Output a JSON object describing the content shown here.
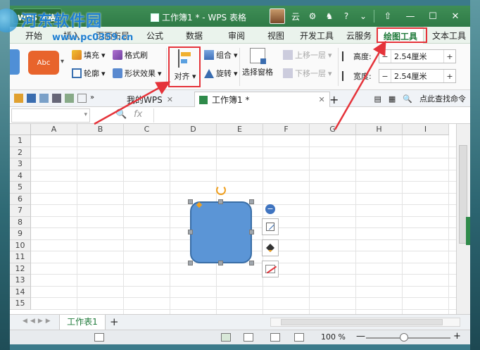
{
  "watermark": {
    "name": "河东软件园",
    "url": "www.pc0359.cn"
  },
  "titlebar": {
    "app_label": "WPS 表格",
    "doc_title": "工作簿1 * - WPS 表格",
    "user_label": "云",
    "min": "—",
    "max": "☐",
    "close": "✕"
  },
  "tabs": [
    {
      "label": "开始"
    },
    {
      "label": "插入"
    },
    {
      "label": "页面布局"
    },
    {
      "label": "公式"
    },
    {
      "label": "数据"
    },
    {
      "label": "审阅"
    },
    {
      "label": "视图"
    },
    {
      "label": "开发工具"
    },
    {
      "label": "云服务"
    },
    {
      "label": "绘图工具"
    },
    {
      "label": "文本工具"
    }
  ],
  "ribbon": {
    "gallery_label": "Abc",
    "fill": "填充",
    "format_painter": "格式刷",
    "outline": "轮廓",
    "shape_effect": "形状效果",
    "align": "对齐",
    "group": "组合",
    "rotate": "旋转",
    "select_pane": "选择窗格",
    "bring_forward": "上移一层",
    "send_backward": "下移一层",
    "height_label": "高度:",
    "width_label": "宽度:",
    "height_value": "2.54厘米",
    "width_value": "2.54厘米"
  },
  "docbar": {
    "tab_mywps": "我的WPS",
    "tab_workbook": "工作簿1 *",
    "add": "+",
    "search": "点此查找命令"
  },
  "formula": {
    "zoom_icon": "🔍",
    "fx": "fx"
  },
  "grid": {
    "columns": [
      "A",
      "B",
      "C",
      "D",
      "E",
      "F",
      "G",
      "H",
      "I"
    ],
    "rows": [
      "1",
      "2",
      "3",
      "4",
      "5",
      "6",
      "7",
      "8",
      "9",
      "10",
      "11",
      "12",
      "13",
      "14",
      "15"
    ]
  },
  "sheets": {
    "tab1": "工作表1",
    "add": "+"
  },
  "status": {
    "zoom": "100 %",
    "minus": "—",
    "plus": "+"
  },
  "colors": {
    "title_green": "#2f7a46",
    "accent_red": "#e5333a",
    "shape_blue": "#5b95d6"
  }
}
